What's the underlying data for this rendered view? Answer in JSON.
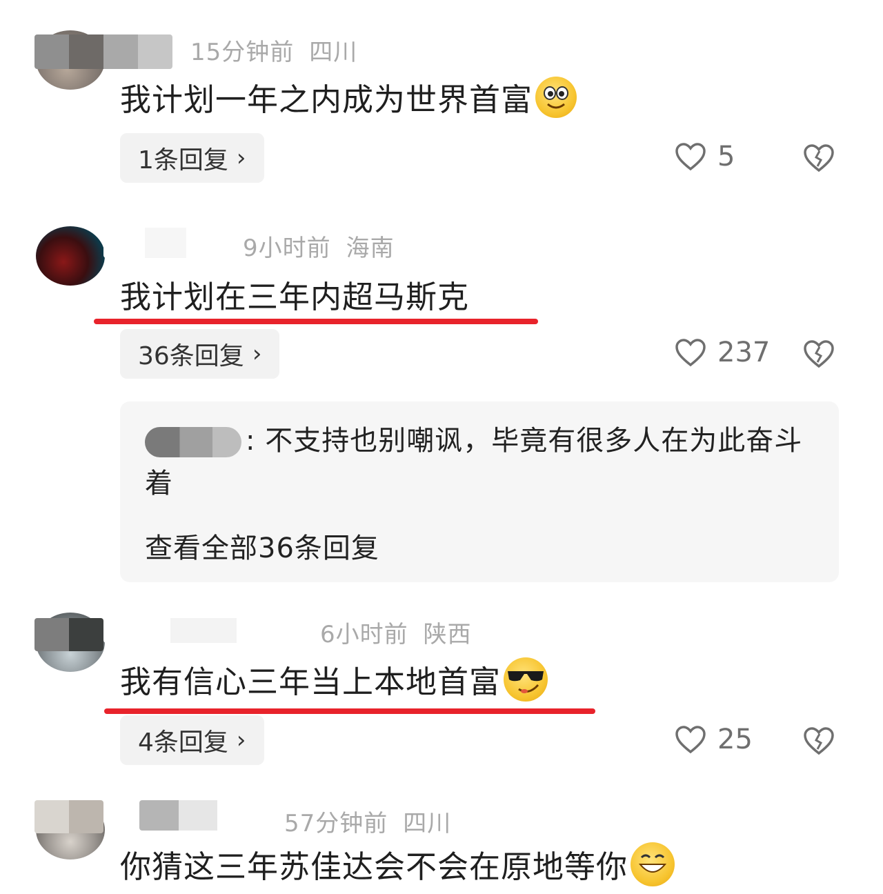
{
  "comments": [
    {
      "time": "15分钟前",
      "location": "四川",
      "text": "我计划一年之内成为世界首富",
      "emoji": "smiling-face-emoji",
      "replies_label": "1条回复",
      "likes": "5",
      "underlined": false
    },
    {
      "time": "9小时前",
      "location": "海南",
      "text": "我计划在三年内超马斯克",
      "replies_label": "36条回复",
      "likes": "237",
      "underlined": true,
      "reply_preview": {
        "separator": ":",
        "text": "不支持也别嘲讽，毕竟有很多人在为此奋斗着",
        "view_all": "查看全部36条回复"
      }
    },
    {
      "time": "6小时前",
      "location": "陕西",
      "text": "我有信心三年当上本地首富",
      "emoji": "sunglasses-emoji",
      "replies_label": "4条回复",
      "likes": "25",
      "underlined": true
    },
    {
      "time": "57分钟前",
      "location": "四川",
      "text": "你猜这三年苏佳达会不会在原地等你",
      "emoji": "grinning-emoji"
    }
  ],
  "colors": {
    "underline": "#e8232b",
    "meta_text": "#a9a9a9",
    "pill_bg": "#f2f2f2"
  },
  "icons": {
    "like": "heart-outline-icon",
    "dislike": "broken-heart-icon",
    "reply_chevron": "chevron-right-icon"
  }
}
